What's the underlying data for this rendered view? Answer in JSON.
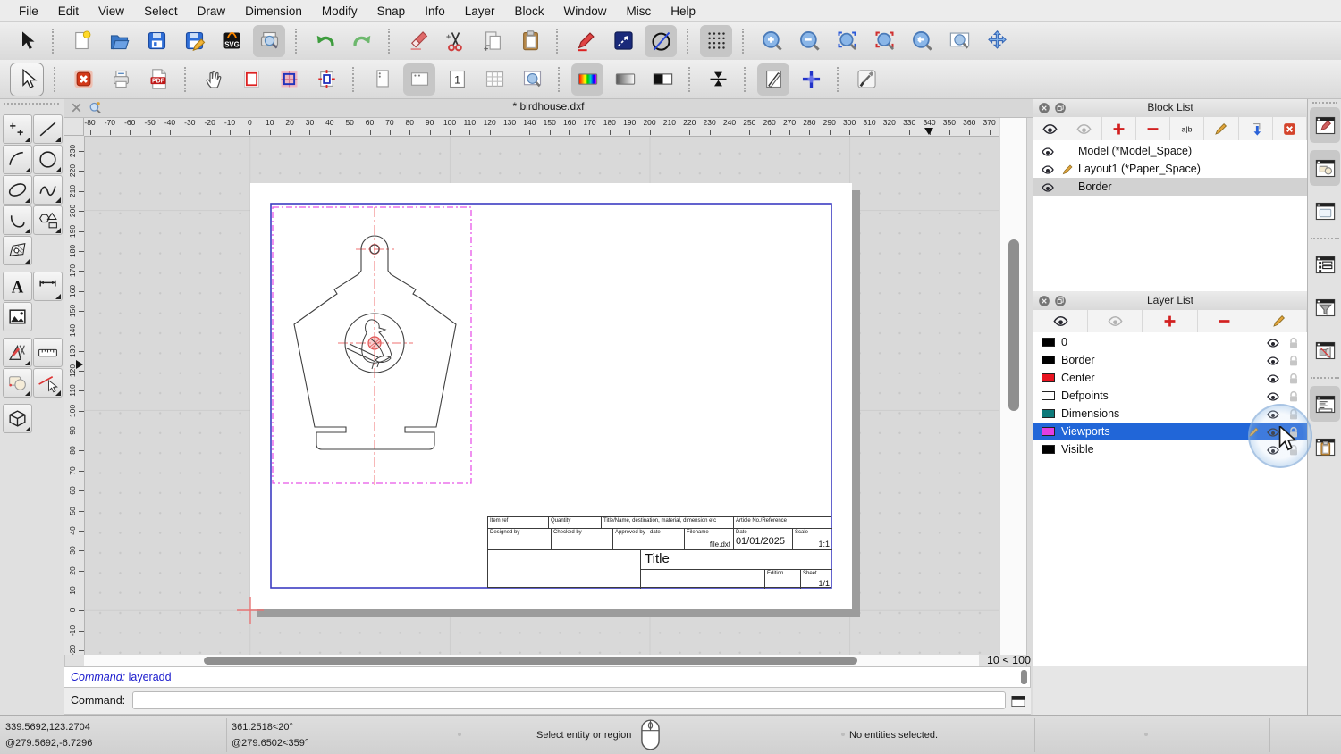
{
  "menu": {
    "items": [
      "File",
      "Edit",
      "View",
      "Select",
      "Draw",
      "Dimension",
      "Modify",
      "Snap",
      "Info",
      "Layer",
      "Block",
      "Window",
      "Misc",
      "Help"
    ]
  },
  "tabbar": {
    "title": "* birdhouse.dxf"
  },
  "toolbar_main": {
    "items": [
      {
        "icon": "cursor",
        "name": "select-pointer"
      },
      "sep",
      {
        "icon": "new",
        "name": "new-document"
      },
      {
        "icon": "open",
        "name": "open-document"
      },
      {
        "icon": "save",
        "name": "save-document"
      },
      {
        "icon": "saveas",
        "name": "save-as"
      },
      {
        "icon": "svg",
        "name": "export-svg"
      },
      {
        "icon": "preview",
        "name": "print-preview",
        "active": true
      },
      "sep",
      {
        "icon": "undo",
        "name": "undo"
      },
      {
        "icon": "redo",
        "name": "redo"
      },
      "sep",
      {
        "icon": "eraser",
        "name": "delete-entities"
      },
      {
        "icon": "cut",
        "name": "cut"
      },
      {
        "icon": "copy",
        "name": "copy"
      },
      {
        "icon": "paste",
        "name": "paste"
      },
      "sep",
      {
        "icon": "pen",
        "name": "edit-pen"
      },
      {
        "icon": "pline",
        "name": "polyline-box"
      },
      {
        "icon": "circline",
        "name": "draw-order",
        "active": true
      },
      "sep",
      {
        "icon": "griddots",
        "name": "snap-grid",
        "active": true
      },
      "sep",
      {
        "icon": "zin",
        "name": "zoom-in"
      },
      {
        "icon": "zout",
        "name": "zoom-out"
      },
      {
        "icon": "zfit",
        "name": "zoom-auto"
      },
      {
        "icon": "zsel",
        "name": "zoom-selection"
      },
      {
        "icon": "zprev",
        "name": "zoom-previous"
      },
      {
        "icon": "zwin",
        "name": "zoom-window"
      },
      {
        "icon": "zpan",
        "name": "zoom-pan"
      }
    ]
  },
  "toolbar_layout": {
    "items": [
      {
        "icon": "cursor2",
        "name": "selection-pointer",
        "boxed": true
      },
      "sep",
      {
        "icon": "closedoc",
        "name": "close-drawing"
      },
      {
        "icon": "print",
        "name": "print"
      },
      {
        "icon": "pdf",
        "name": "export-pdf"
      },
      "sep",
      {
        "icon": "hand",
        "name": "pan-hand"
      },
      {
        "icon": "vprect",
        "name": "viewport-outline"
      },
      {
        "icon": "vpfill",
        "name": "viewport-fill"
      },
      {
        "icon": "vparrow",
        "name": "viewport-fit"
      },
      "sep",
      {
        "icon": "pagep",
        "name": "page-portrait"
      },
      {
        "icon": "pagel",
        "name": "page-landscape",
        "active": true
      },
      {
        "icon": "page1",
        "name": "single-page"
      },
      {
        "icon": "grid9",
        "name": "multi-page-grid"
      },
      {
        "icon": "zpage",
        "name": "zoom-page"
      },
      "sep",
      {
        "icon": "colorbar",
        "name": "full-color-mode",
        "active": true
      },
      {
        "icon": "graybar",
        "name": "grayscale-mode"
      },
      {
        "icon": "bwbar",
        "name": "black-white-mode"
      },
      "sep",
      {
        "icon": "mirror",
        "name": "fixed-ratio"
      },
      "sep",
      {
        "icon": "draft",
        "name": "draft-mode",
        "active": true
      },
      {
        "icon": "cross",
        "name": "show-crosshair"
      },
      "sep",
      {
        "icon": "tools",
        "name": "settings-tools"
      }
    ]
  },
  "palette": {
    "rows": [
      [
        {
          "icon": "pal-pt",
          "name": "points-tool",
          "corner": true
        },
        {
          "icon": "pal-line",
          "name": "line-tool",
          "corner": true
        }
      ],
      [
        {
          "icon": "pal-arc",
          "name": "arc-tool",
          "corner": true
        },
        {
          "icon": "pal-circle",
          "name": "circle-tool",
          "corner": true
        }
      ],
      [
        {
          "icon": "pal-ellipse",
          "name": "ellipse-tool",
          "corner": true
        },
        {
          "icon": "pal-spline",
          "name": "spline-tool",
          "corner": true
        }
      ],
      [
        {
          "icon": "pal-pline",
          "name": "polyline-tool",
          "corner": true
        },
        {
          "icon": "pal-polygon",
          "name": "polygon-tool",
          "corner": true
        }
      ],
      [
        {
          "icon": "pal-hatch",
          "name": "hatch-tool",
          "corner": true
        },
        null
      ],
      "gap",
      [
        {
          "icon": "pal-text",
          "name": "text-tool",
          "corner": false
        },
        {
          "icon": "pal-dim",
          "name": "dimension-tool",
          "corner": true
        }
      ],
      [
        {
          "icon": "pal-image",
          "name": "image-tool",
          "corner": false
        },
        null
      ],
      "gap",
      [
        {
          "icon": "pal-cadkit",
          "name": "draw-kit-tool",
          "corner": true
        },
        {
          "icon": "pal-measure",
          "name": "measure-tool",
          "corner": false
        }
      ],
      [
        {
          "icon": "pal-modify",
          "name": "modify-tool",
          "corner": true
        },
        {
          "icon": "pal-select",
          "name": "select-tool",
          "corner": true
        }
      ],
      "gap",
      [
        {
          "icon": "pal-solid",
          "name": "solid-tool",
          "corner": true
        },
        null
      ]
    ]
  },
  "rulers": {
    "h_values": [
      -80,
      -70,
      -60,
      -50,
      -40,
      -30,
      -20,
      -10,
      0,
      10,
      20,
      30,
      40,
      50,
      60,
      70,
      80,
      90,
      100,
      110,
      120,
      130,
      140,
      150,
      160,
      170,
      180,
      190,
      200,
      210,
      220,
      230,
      240,
      250,
      260,
      270,
      280,
      290,
      300,
      310,
      320,
      330,
      340,
      350,
      360,
      370
    ],
    "v_values": [
      230,
      220,
      210,
      200,
      190,
      180,
      170,
      160,
      150,
      140,
      130,
      120,
      110,
      100,
      90,
      80,
      70,
      60,
      50,
      40,
      30,
      20,
      10,
      0,
      -10,
      -20
    ],
    "h_marker_value": 339.6,
    "v_marker_value": 123.3
  },
  "drawing": {
    "title_block": {
      "item_ref": "Item ref",
      "quantity": "Quantity",
      "title_name": "Title/Name, destination, material, dimension etc",
      "article": "Article No./Reference",
      "designed_by": "Designed by",
      "checked_by": "Checked by",
      "approved_by": "Approved by - date",
      "filename_label": "Filename",
      "filename_value": "file.dxf",
      "date_label": "Date",
      "date_value": "01/01/2025",
      "scale_label": "Scale",
      "scale_value": "1:1",
      "title": "Title",
      "edition_label": "Edition",
      "sheet_label": "Sheet",
      "sheet_value": "1/1"
    }
  },
  "block_list": {
    "title": "Block List",
    "toolbar": [
      {
        "icon": "eye",
        "name": "show-all-blocks"
      },
      {
        "icon": "eyegray",
        "name": "hide-all-blocks"
      },
      {
        "icon": "plus",
        "name": "add-block"
      },
      {
        "icon": "minus",
        "name": "remove-block"
      },
      {
        "icon": "ab",
        "name": "rename-block"
      },
      {
        "icon": "pencil",
        "name": "edit-block"
      },
      {
        "icon": "insert",
        "name": "insert-block"
      },
      {
        "icon": "delx",
        "name": "delete-block"
      }
    ],
    "items": [
      {
        "name": "Model (*Model_Space)",
        "editing": false,
        "selected": false
      },
      {
        "name": "Layout1 (*Paper_Space)",
        "editing": true,
        "selected": false
      },
      {
        "name": "Border",
        "editing": false,
        "selected": true
      }
    ]
  },
  "layer_list": {
    "title": "Layer List",
    "toolbar": [
      {
        "icon": "eye",
        "name": "show-all-layers"
      },
      {
        "icon": "eyegray",
        "name": "hide-all-layers"
      },
      {
        "icon": "plus",
        "name": "add-layer"
      },
      {
        "icon": "minus",
        "name": "remove-layer"
      },
      {
        "icon": "pencil",
        "name": "modify-layer"
      }
    ],
    "items": [
      {
        "name": "0",
        "color": "#000000",
        "selected": false,
        "editing": false
      },
      {
        "name": "Border",
        "color": "#000000",
        "selected": false,
        "editing": false
      },
      {
        "name": "Center",
        "color": "#e81420",
        "selected": false,
        "editing": false
      },
      {
        "name": "Defpoints",
        "color": "#ffffff",
        "selected": false,
        "editing": false
      },
      {
        "name": "Dimensions",
        "color": "#0d7a7a",
        "selected": false,
        "editing": false
      },
      {
        "name": "Viewports",
        "color": "#e23ee2",
        "selected": true,
        "editing": true
      },
      {
        "name": "Visible",
        "color": "#000000",
        "selected": false,
        "editing": false
      }
    ]
  },
  "dock": {
    "items": [
      {
        "icon": "dock-block",
        "name": "block-list-dock",
        "active": true
      },
      {
        "icon": "dock-library",
        "name": "library-browser-dock",
        "active": true
      },
      {
        "icon": "dock-plain",
        "name": "quick-info-dock",
        "active": false
      },
      "gap",
      {
        "icon": "dock-list",
        "name": "layer-list-dock",
        "active": false
      },
      {
        "icon": "dock-filter",
        "name": "selection-filter-dock",
        "active": false
      },
      {
        "icon": "dock-views",
        "name": "named-views-dock",
        "active": false
      },
      "gap",
      {
        "icon": "dock-cmd",
        "name": "command-line-dock",
        "active": true
      },
      {
        "icon": "dock-clip",
        "name": "clipboard-dock",
        "active": false
      }
    ]
  },
  "scrollbars": {
    "zoom_indicator": "10 < 100"
  },
  "command": {
    "history_prefix": "Command:",
    "history_command": "layeradd",
    "prompt_label": "Command:"
  },
  "status": {
    "coord_abs": "339.5692,123.2704",
    "coord_rel": "@279.5692,-6.7296",
    "polar_abs": "361.2518<20°",
    "polar_rel": "@279.6502<359°",
    "hint": "Select entity or region",
    "selection": "No entities selected."
  }
}
